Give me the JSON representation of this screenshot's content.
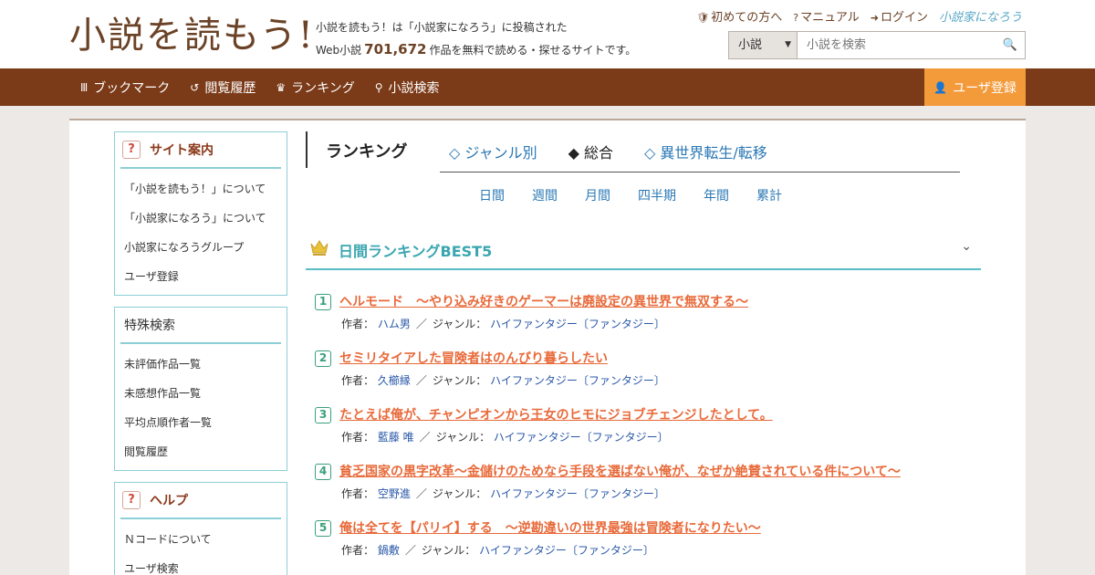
{
  "header": {
    "logo": "小説を読もう!",
    "tagline_line1": "小説を読もう！は「小説家になろう」に投稿された",
    "tagline_prefix": "Web小説",
    "novel_count": "701,672",
    "tagline_suffix": "作品を無料で読める・探せるサイトです。",
    "links": {
      "first_time": "初めての方へ",
      "manual": "マニュアル",
      "login": "ログイン",
      "brand": "小説家になろう"
    },
    "search": {
      "category": "小説",
      "placeholder": "小説を検索"
    }
  },
  "nav": {
    "bookmark": "ブックマーク",
    "history": "閲覧履歴",
    "ranking": "ランキング",
    "novel_search": "小説検索",
    "register": "ユーザ登録"
  },
  "sidebar": {
    "site_info": {
      "title": "サイト案内",
      "items": [
        "「小説を読もう！」について",
        "「小説家になろう」について",
        "小説家になろうグループ",
        "ユーザ登録"
      ]
    },
    "special_search": {
      "title": "特殊検索",
      "items": [
        "未評価作品一覧",
        "未感想作品一覧",
        "平均点順作者一覧",
        "閲覧履歴"
      ]
    },
    "help": {
      "title": "ヘルプ",
      "items": [
        "Ｎコードについて",
        "ユーザ検索"
      ]
    }
  },
  "ranking": {
    "title": "ランキング",
    "tabs": [
      "◇ ジャンル別",
      "◆ 総合",
      "◇ 異世界転生/転移"
    ],
    "periods": [
      "日間",
      "週間",
      "月間",
      "四半期",
      "年間",
      "累計"
    ],
    "best5_title": "日間ランキングBEST5",
    "author_label": "作者：",
    "genre_label": "ジャンル：",
    "entries": [
      {
        "rank": "1",
        "title": "ヘルモード　～やり込み好きのゲーマーは廃設定の異世界で無双する～",
        "author": "ハム男",
        "genre": "ハイファンタジー〔ファンタジー〕"
      },
      {
        "rank": "2",
        "title": "セミリタイアした冒険者はのんびり暮らしたい",
        "author": "久櫛縁",
        "genre": "ハイファンタジー〔ファンタジー〕"
      },
      {
        "rank": "3",
        "title": "たとえば俺が、チャンピオンから王女のヒモにジョブチェンジしたとして。",
        "author": "藍藤 唯",
        "genre": "ハイファンタジー〔ファンタジー〕"
      },
      {
        "rank": "4",
        "title": "貧乏国家の黒字改革〜金儲けのためなら手段を選ばない俺が、なぜか絶賛されている件について〜",
        "author": "空野進",
        "genre": "ハイファンタジー〔ファンタジー〕"
      },
      {
        "rank": "5",
        "title": "俺は全てを【パリイ】する　〜逆勘違いの世界最強は冒険者になりたい〜",
        "author": "鍋敷",
        "genre": "ハイファンタジー〔ファンタジー〕"
      }
    ]
  }
}
